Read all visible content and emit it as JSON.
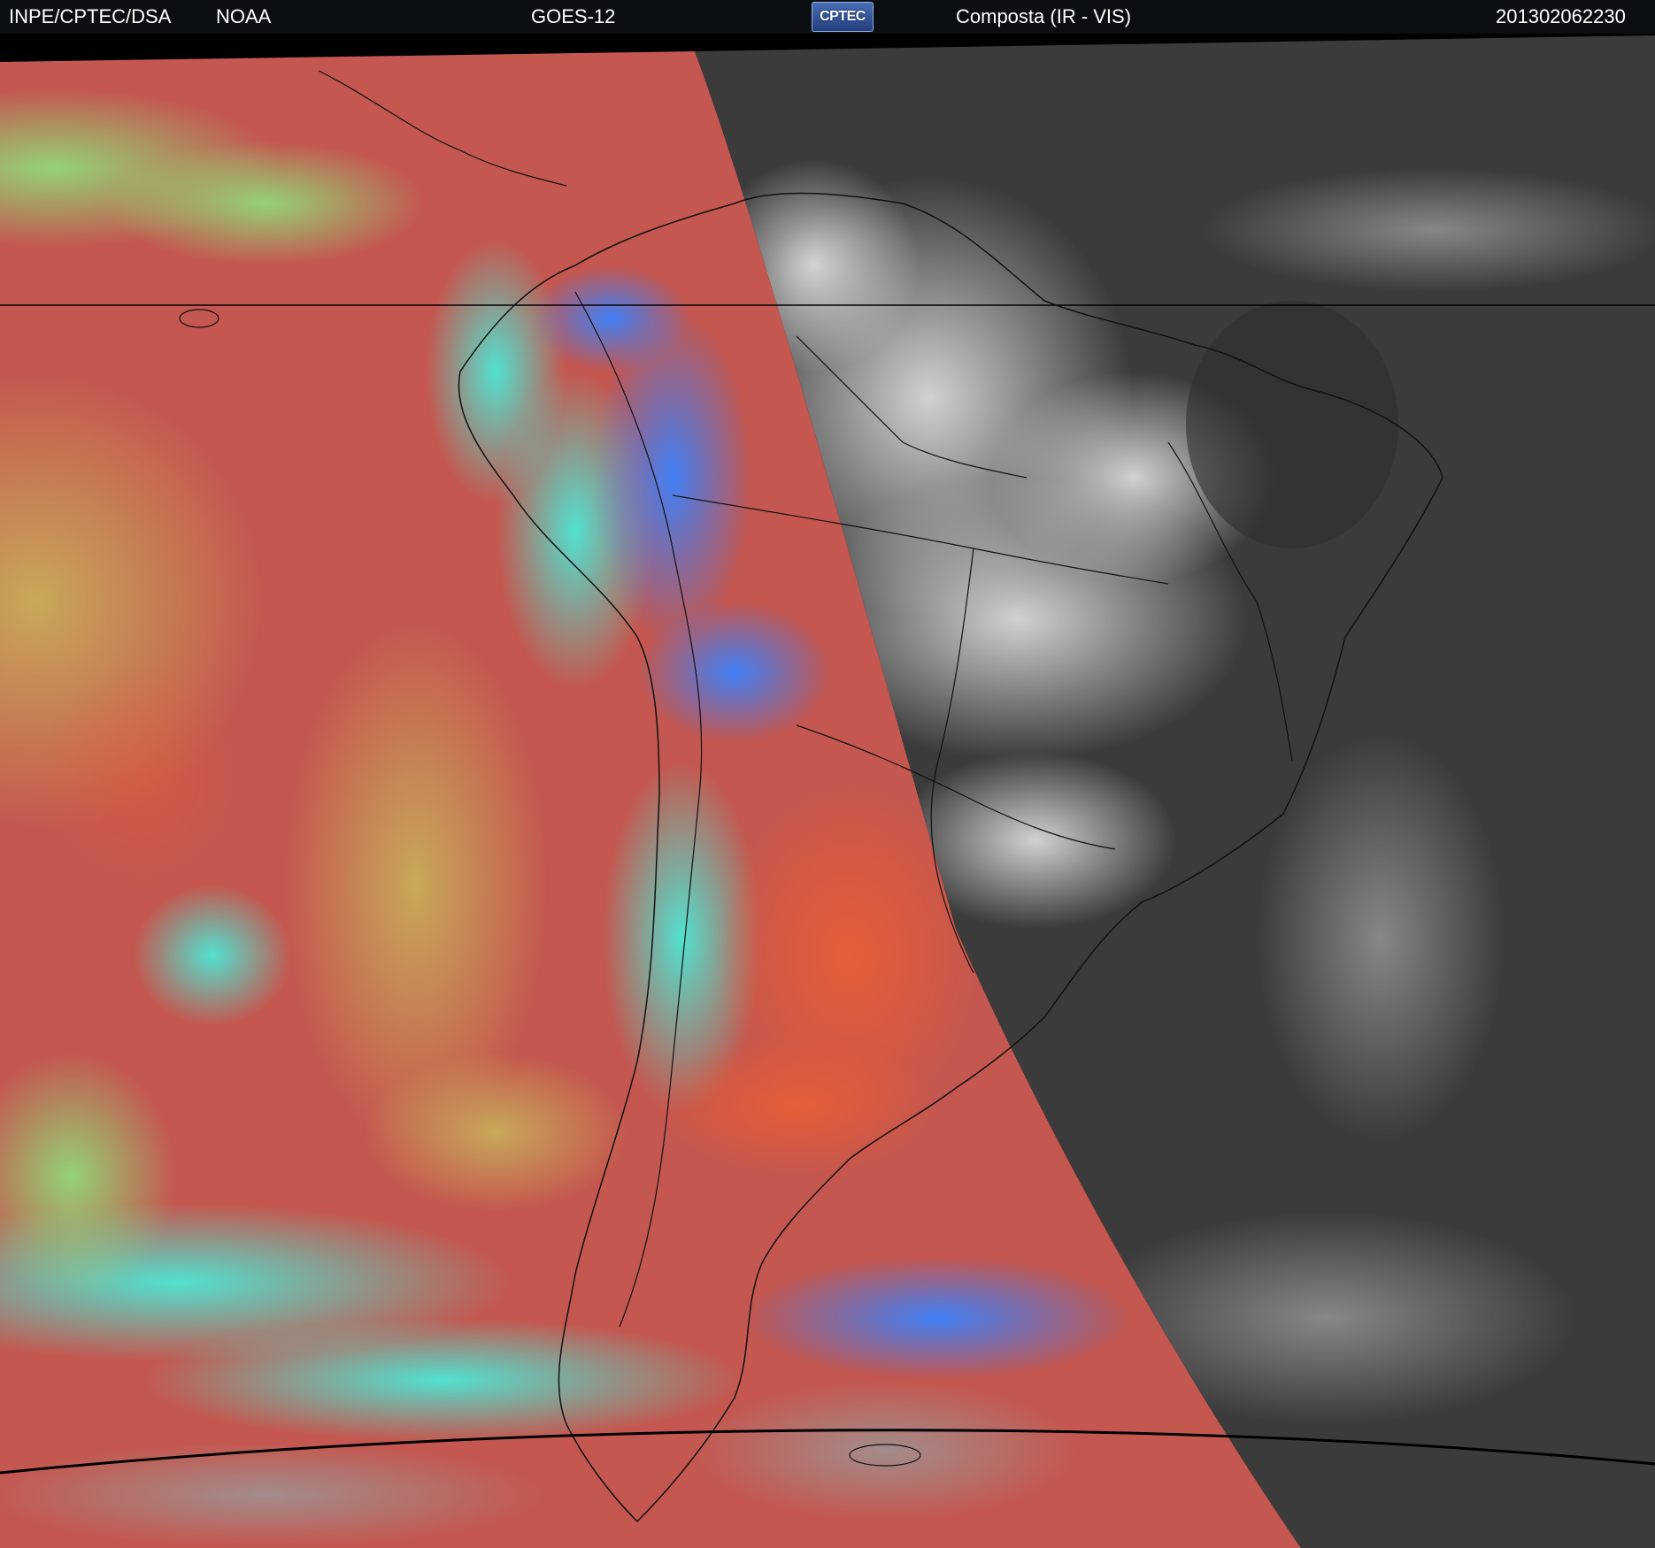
{
  "header": {
    "agency": "INPE/CPTEC/DSA",
    "partner": "NOAA",
    "satellite": "GOES-12",
    "logo_text": "CPTEC",
    "product": "Composta (IR - VIS)",
    "timestamp": "201302062230"
  },
  "colors": {
    "header_bg": "#0c0f12",
    "ir_red": "#c9584f",
    "ir_orange": "#e0603a",
    "ir_yellow": "#c8b25a",
    "ir_green": "#7fdc7a",
    "ir_cyan": "#3fe0d8",
    "ir_blue": "#3a7dff",
    "vis_gray": "#3c3c3c",
    "vis_cloud": "#d8d8d8"
  }
}
